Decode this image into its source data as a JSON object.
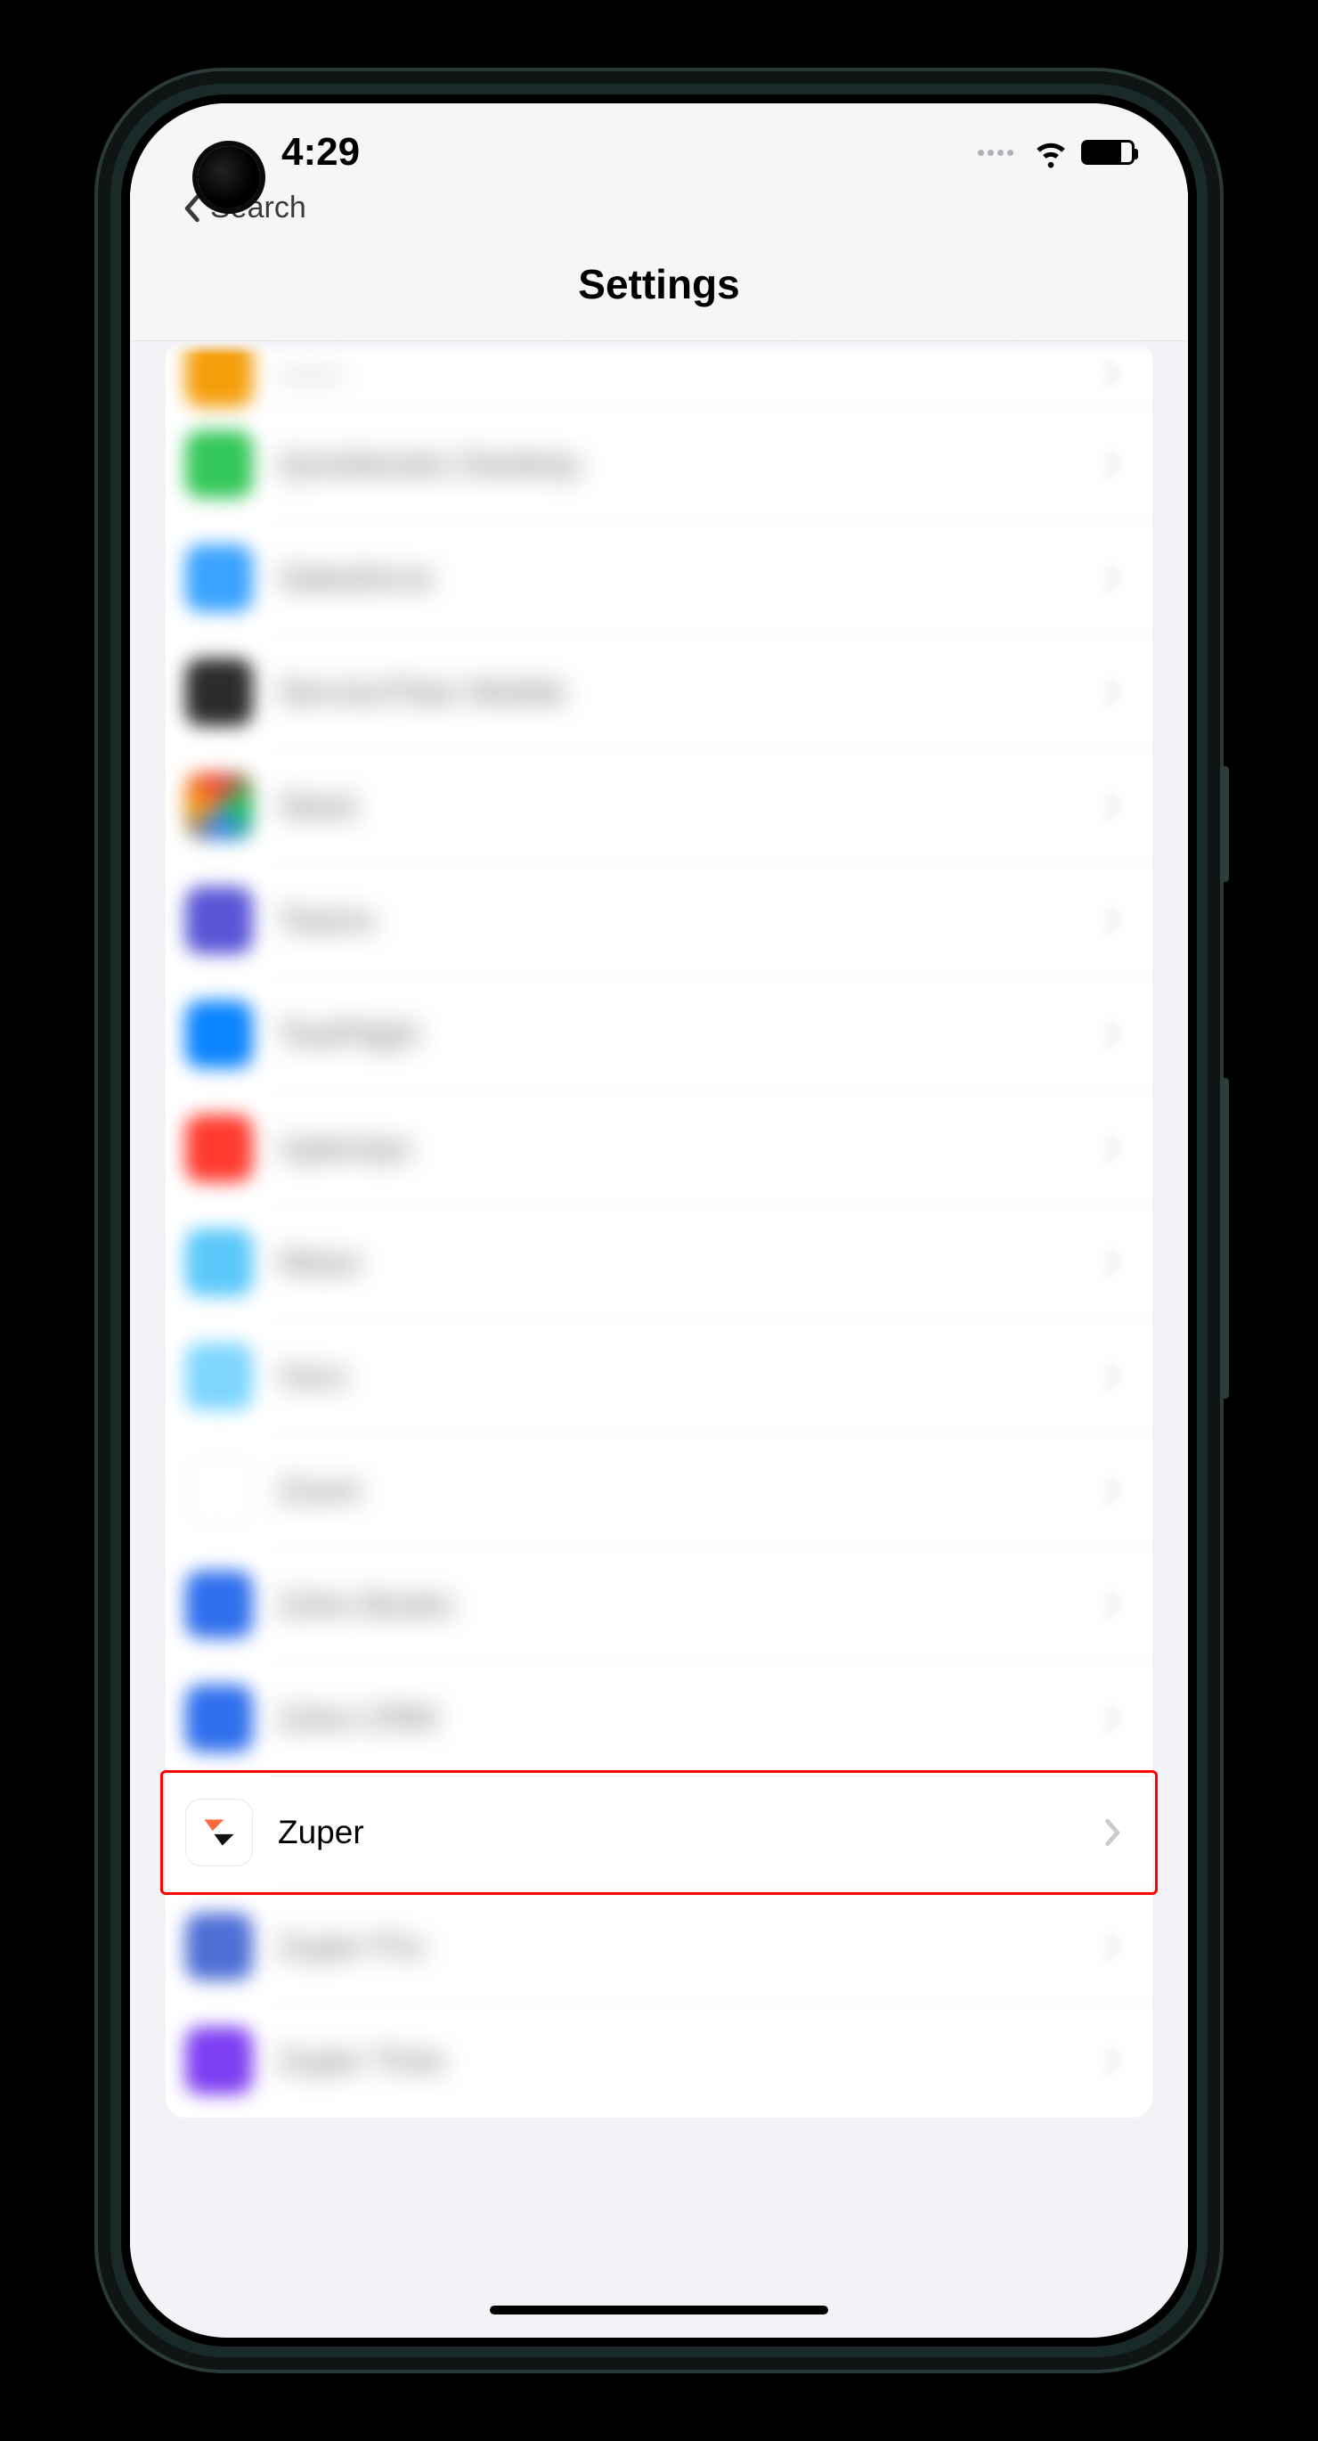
{
  "status": {
    "time": "4:29"
  },
  "nav": {
    "back_label": "Search",
    "title": "Settings"
  },
  "apps": [
    {
      "id": "row0",
      "label": "——",
      "icon_class": "ic-orange",
      "blurred": true,
      "partial": true,
      "highlighted": false
    },
    {
      "id": "row1",
      "label": "Quickbooks Desktop",
      "icon_class": "ic-green",
      "blurred": true,
      "partial": false,
      "highlighted": false
    },
    {
      "id": "row2",
      "label": "Salesforce",
      "icon_class": "ic-skyblue",
      "blurred": true,
      "partial": false,
      "highlighted": false
    },
    {
      "id": "row3",
      "label": "ServiceTitan Mobile",
      "icon_class": "ic-dark",
      "blurred": true,
      "partial": false,
      "highlighted": false
    },
    {
      "id": "row4",
      "label": "Slack",
      "icon_class": "ic-multi",
      "blurred": true,
      "partial": false,
      "highlighted": false
    },
    {
      "id": "row5",
      "label": "Teams",
      "icon_class": "ic-indigo",
      "blurred": true,
      "partial": false,
      "highlighted": false
    },
    {
      "id": "row6",
      "label": "TestFlight",
      "icon_class": "ic-blue",
      "blurred": true,
      "partial": false,
      "highlighted": false
    },
    {
      "id": "row7",
      "label": "Uptempo",
      "icon_class": "ic-red",
      "blurred": true,
      "partial": false,
      "highlighted": false
    },
    {
      "id": "row8",
      "label": "Waze",
      "icon_class": "ic-teal",
      "blurred": true,
      "partial": false,
      "highlighted": false
    },
    {
      "id": "row9",
      "label": "Xero",
      "icon_class": "ic-ltteal",
      "blurred": true,
      "partial": false,
      "highlighted": false
    },
    {
      "id": "row10",
      "label": "Zoom",
      "icon_class": "ic-white",
      "blurred": true,
      "partial": false,
      "highlighted": false
    },
    {
      "id": "row11",
      "label": "Zoho Books",
      "icon_class": "ic-blue2",
      "blurred": true,
      "partial": false,
      "highlighted": false
    },
    {
      "id": "row12",
      "label": "Zoho CRM",
      "icon_class": "ic-blue2",
      "blurred": true,
      "partial": false,
      "highlighted": false
    },
    {
      "id": "row13",
      "label": "Zuper",
      "icon_class": "zuper",
      "blurred": false,
      "partial": false,
      "highlighted": true
    },
    {
      "id": "row14",
      "label": "Zuper Pro",
      "icon_class": "ic-blue3",
      "blurred": true,
      "partial": false,
      "highlighted": false
    },
    {
      "id": "row15",
      "label": "Zuper Time",
      "icon_class": "ic-purple",
      "blurred": true,
      "partial": false,
      "highlighted": false
    }
  ]
}
